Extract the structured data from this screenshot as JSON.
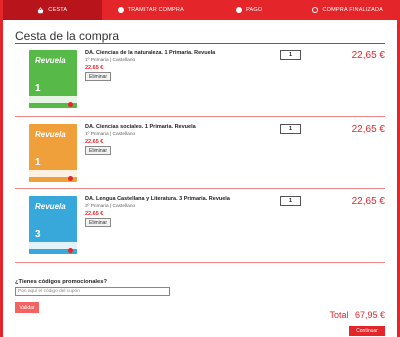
{
  "steps": [
    {
      "label": "Cesta",
      "icon": "basket-icon",
      "active": true
    },
    {
      "label": "Tramitar compra",
      "icon": "dot-icon",
      "active": false
    },
    {
      "label": "Pago",
      "icon": "dot-icon",
      "active": false
    },
    {
      "label": "Compra finalizada",
      "icon": "ring-icon",
      "active": false
    }
  ],
  "page_title": "Cesta de la compra",
  "items": [
    {
      "title": "DA. Ciencias de la naturaleza. 1 Primaria. Revuela",
      "meta": "1º Primaria | Castellano",
      "unit_price": "22,65 €",
      "remove_label": "Eliminar",
      "quantity": "1",
      "total": "22,65 €",
      "cover_brand": "Revuela",
      "cover_number": "1",
      "cover_color": "#57b947"
    },
    {
      "title": "DA. Ciencias sociales. 1 Primaria. Revuela",
      "meta": "1º Primaria | Castellano",
      "unit_price": "22,65 €",
      "remove_label": "Eliminar",
      "quantity": "1",
      "total": "22,65 €",
      "cover_brand": "Revuela",
      "cover_number": "1",
      "cover_color": "#f0a03a"
    },
    {
      "title": "DA. Lengua Castellana y Literatura. 3 Primaria. Revuela",
      "meta": "3º Primaria | Castellano",
      "unit_price": "22,65 €",
      "remove_label": "Eliminar",
      "quantity": "1",
      "total": "22,65 €",
      "cover_brand": "Revuela",
      "cover_number": "3",
      "cover_color": "#38a8db"
    }
  ],
  "promo": {
    "label": "¿Tienes códigos promocionales?",
    "placeholder": "Pon aquí el código del cupón",
    "button": "Validar"
  },
  "summary": {
    "total_label": "Total",
    "total_value": "67,95 €",
    "continue_label": "Continuar"
  },
  "colors": {
    "accent": "#e4262a",
    "accent_dark": "#b7141c"
  }
}
